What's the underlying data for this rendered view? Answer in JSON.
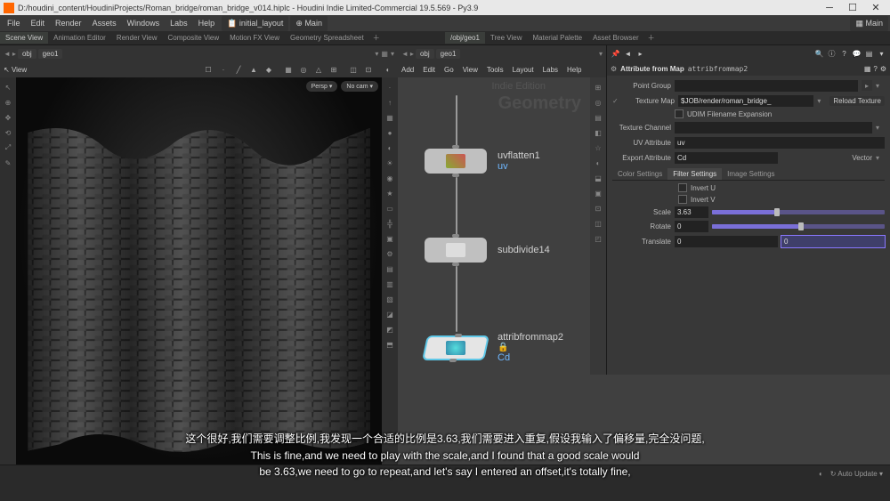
{
  "title_bar": {
    "path": "D:/houdini_content/HoudiniProjects/Roman_bridge/roman_bridge_v014.hiplc - Houdini Indie Limited-Commercial 19.5.569 - Py3.9"
  },
  "menu": {
    "items": [
      "File",
      "Edit",
      "Render",
      "Assets",
      "Windows",
      "Labs",
      "Help"
    ],
    "layout_presets": [
      "initial_layout",
      "Main"
    ],
    "right_label": "Main"
  },
  "left_tabs": {
    "items": [
      "Scene View",
      "Animation Editor",
      "Render View",
      "Composite View",
      "Motion FX View",
      "Geometry Spreadsheet"
    ],
    "selected": 0
  },
  "right_tabs": {
    "items": [
      "/obj/geo1",
      "Tree View",
      "Material Palette",
      "Asset Browser"
    ],
    "selected": 0
  },
  "breadcrumb_left": {
    "root": "obj",
    "node": "geo1"
  },
  "viewport": {
    "label": "View",
    "persp": "Persp",
    "cam": "No cam"
  },
  "node_graph": {
    "breadcrumb": {
      "root": "obj",
      "node": "geo1"
    },
    "menus": [
      "Add",
      "Edit",
      "Go",
      "View",
      "Tools",
      "Layout",
      "Labs",
      "Help"
    ],
    "bg_main": "Geometry",
    "bg_sub": "Indie Edition",
    "nodes": [
      {
        "name": "uvflatten1",
        "sub": "uv"
      },
      {
        "name": "subdivide14",
        "sub": ""
      },
      {
        "name": "attribfrommap2",
        "sub": "Cd"
      }
    ]
  },
  "params": {
    "header": "Attribute from Map",
    "op_name": "attribfrommap2",
    "rows": {
      "point_group_label": "Point Group",
      "point_group": "",
      "texture_map_label": "Texture Map",
      "texture_map": "$JOB/render/roman_bridge_",
      "reload_btn": "Reload Texture",
      "udim_label": "UDIM Filename Expansion",
      "texture_channel_label": "Texture Channel",
      "texture_channel": "",
      "uv_attr_label": "UV Attribute",
      "uv_attr": "uv",
      "export_attr_label": "Export Attribute",
      "export_attr": "Cd",
      "export_type": "Vector"
    },
    "tabs": [
      "Color Settings",
      "Filter Settings",
      "Image Settings"
    ],
    "tab_selected": 1,
    "filter": {
      "invert_u": "Invert U",
      "invert_v": "Invert V",
      "scale_label": "Scale",
      "scale": "3.63",
      "rotate_label": "Rotate",
      "rotate": "0",
      "translate_label": "Translate",
      "tx": "0",
      "ty": "0"
    }
  },
  "status": {
    "auto_update": "Auto Update"
  },
  "subtitle": {
    "cn": "这个很好,我们需要调整比例,我发现一个合适的比例是3.63,我们需要进入重复,假设我输入了偏移量,完全没问题,",
    "en1": "This is fine,and we need to play with the scale,and I found that a good scale would",
    "en2": "be 3.63,we need to go to repeat,and let's say I entered an offset,it's totally fine,"
  }
}
